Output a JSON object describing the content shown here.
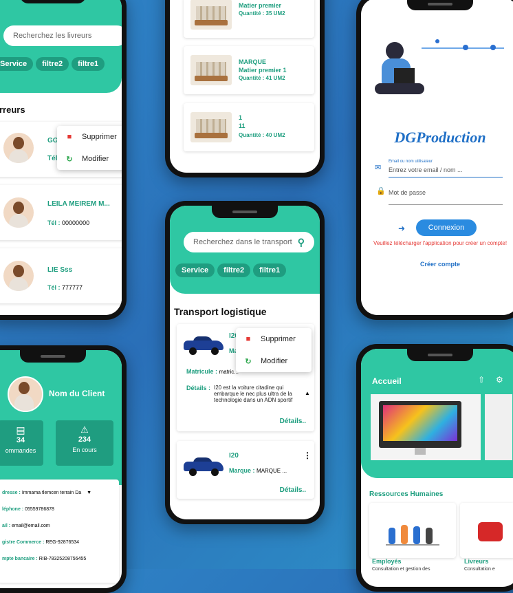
{
  "phone_livreurs": {
    "search_placeholder": "Recherchez les livreurs",
    "filters": [
      "Service",
      "filtre2",
      "filtre1"
    ],
    "section_title": "Livreurs",
    "section_visible": "rreurs",
    "menu": {
      "delete": "Supprimer",
      "edit": "Modifier"
    },
    "items": [
      {
        "name": "GG",
        "tel_label": "Tél"
      },
      {
        "name": "LEILA MEIREM M...",
        "tel_label": "Tél :",
        "tel": "00000000"
      },
      {
        "name": "LIE Sss",
        "tel_label": "Tél :",
        "tel": "777777"
      }
    ]
  },
  "phone_products": {
    "items": [
      {
        "line1": "Matier premier",
        "line2": "Quantité : 35 UM2"
      },
      {
        "line0": "MARQUE",
        "line1": "Matier premier 1",
        "line2": "Quantité : 41 UM2"
      },
      {
        "line0": "1",
        "line1": "11",
        "line2": "Quantité : 40 UM2"
      }
    ]
  },
  "phone_login": {
    "brand": "DGProduction",
    "email_label": "Email ou nom utilisateur",
    "email_placeholder": "Entrez votre email / nom ...",
    "password_placeholder": "Mot de passe",
    "login_button": "Connexion",
    "warning": "Veuillez télécharger l'application pour créer un compte!",
    "create_account": "Créer compte"
  },
  "phone_transport": {
    "search_placeholder": "Recherchez dans le transport",
    "filters": [
      "Service",
      "filtre2",
      "filtre1"
    ],
    "title": "Transport logistique",
    "menu": {
      "delete": "Supprimer",
      "edit": "Modifier"
    },
    "card1": {
      "name": "I20",
      "marque_short": "Ma",
      "matricule_label": "Matricule :",
      "matricule": "matric...",
      "details_label": "Détails :",
      "details": "I20 est la voiture citadine qui embarque le nec plus ultra de la technologie dans un ADN sportif",
      "details_link": "Détails.."
    },
    "card2": {
      "name": "I20",
      "marque_label": "Marque :",
      "marque": "MARQUE ...",
      "details_link": "Détails.."
    }
  },
  "phone_client": {
    "name": "Nom du Client",
    "stats": [
      {
        "value": "34",
        "label": "ommandes"
      },
      {
        "value": "234",
        "label": "En cours"
      }
    ],
    "fields": [
      {
        "label": "dresse :",
        "value": "Immama tlemcen terrain Da"
      },
      {
        "label": "léphone :",
        "value": "05559786878"
      },
      {
        "label": "ail :",
        "value": "email@email.com"
      },
      {
        "label": "gistre Commerce :",
        "value": "REG-92876534"
      },
      {
        "label": "mpte bancaire :",
        "value": "RIB-78325208756455"
      }
    ]
  },
  "phone_home": {
    "title": "Accueil",
    "section": "Ressources Humaines",
    "cards": [
      {
        "title": "Employés",
        "desc": "Consultation et gestion des"
      },
      {
        "title": "Livreurs",
        "desc": "Consultation e"
      }
    ]
  },
  "colors": {
    "teal": "#2fc7a3",
    "dark_teal": "#1f9d80",
    "brand_blue": "#1f6fc6",
    "danger": "#e53935"
  }
}
